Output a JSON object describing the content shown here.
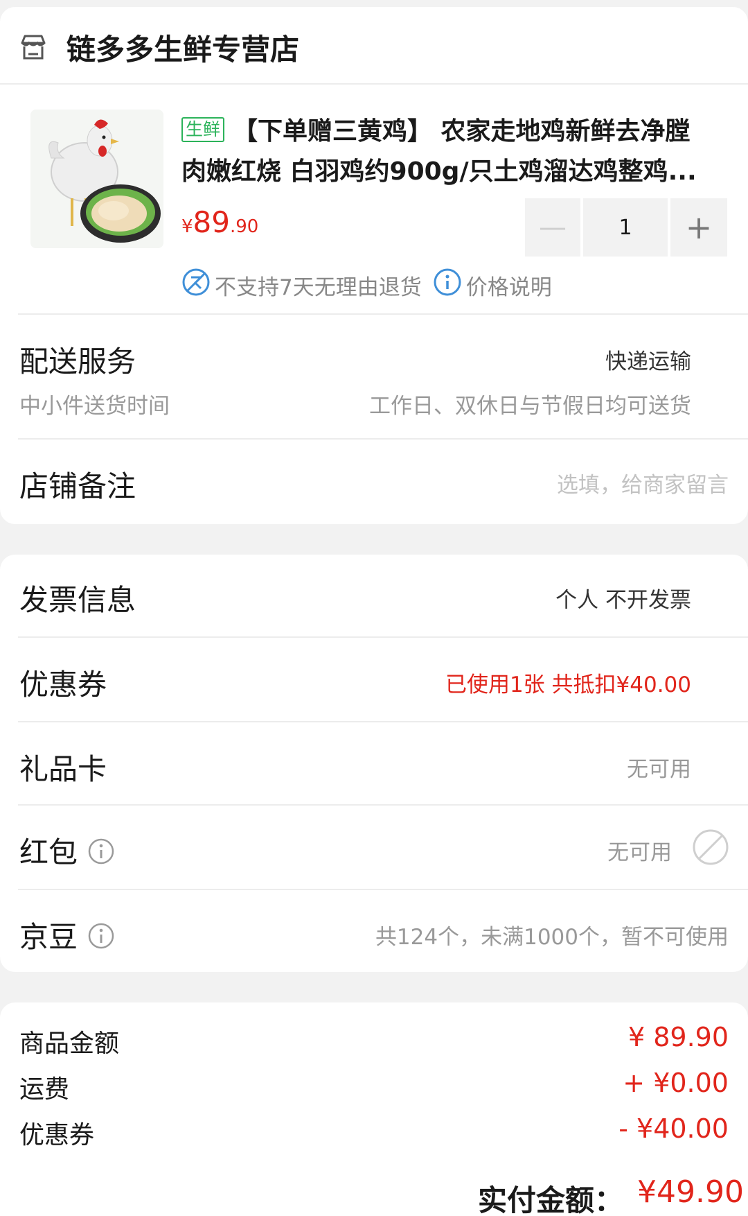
{
  "store": {
    "name": "链多多生鲜专营店",
    "icon": "store-icon"
  },
  "product": {
    "tag": "生鲜",
    "title_line1": "【下单赠三黄鸡】 农家走地鸡新鲜去净膛",
    "title_line2": "肉嫩红烧 白羽鸡约900g/只土鸡溜达鸡整鸡...",
    "price_symbol": "¥",
    "price_int": "89",
    "price_dec": ".90",
    "quantity": "1",
    "minus_label": "—",
    "plus_label": "+",
    "no_return_text": "不支持7天无理由退货",
    "price_info_text": "价格说明",
    "image_icon": "chicken-product-image"
  },
  "delivery": {
    "label": "配送服务",
    "value": "快递运输",
    "sub_label": "中小件送货时间",
    "sub_value": "工作日、双休日与节假日均可送货"
  },
  "remark": {
    "label": "店铺备注",
    "placeholder": "选填，给商家留言"
  },
  "invoice": {
    "label": "发票信息",
    "value": "个人 不开发票"
  },
  "coupon": {
    "label": "优惠券",
    "value": "已使用1张 共抵扣¥40.00"
  },
  "gift_card": {
    "label": "礼品卡",
    "value": "无可用"
  },
  "red_packet": {
    "label": "红包",
    "value": "无可用"
  },
  "jingdou": {
    "label": "京豆",
    "value": "共124个，未满1000个，暂不可使用"
  },
  "summary": {
    "goods_label": "商品金额",
    "goods_value": "¥ 89.90",
    "shipping_label": "运费",
    "shipping_value": "+ ¥0.00",
    "coupon_label": "优惠券",
    "coupon_value": "- ¥40.00",
    "total_label": "实付金额：",
    "total_value": "¥49.90"
  },
  "colors": {
    "accent_red": "#e1251b",
    "fresh_green": "#2bb35a",
    "info_blue": "#3f8fd8"
  }
}
